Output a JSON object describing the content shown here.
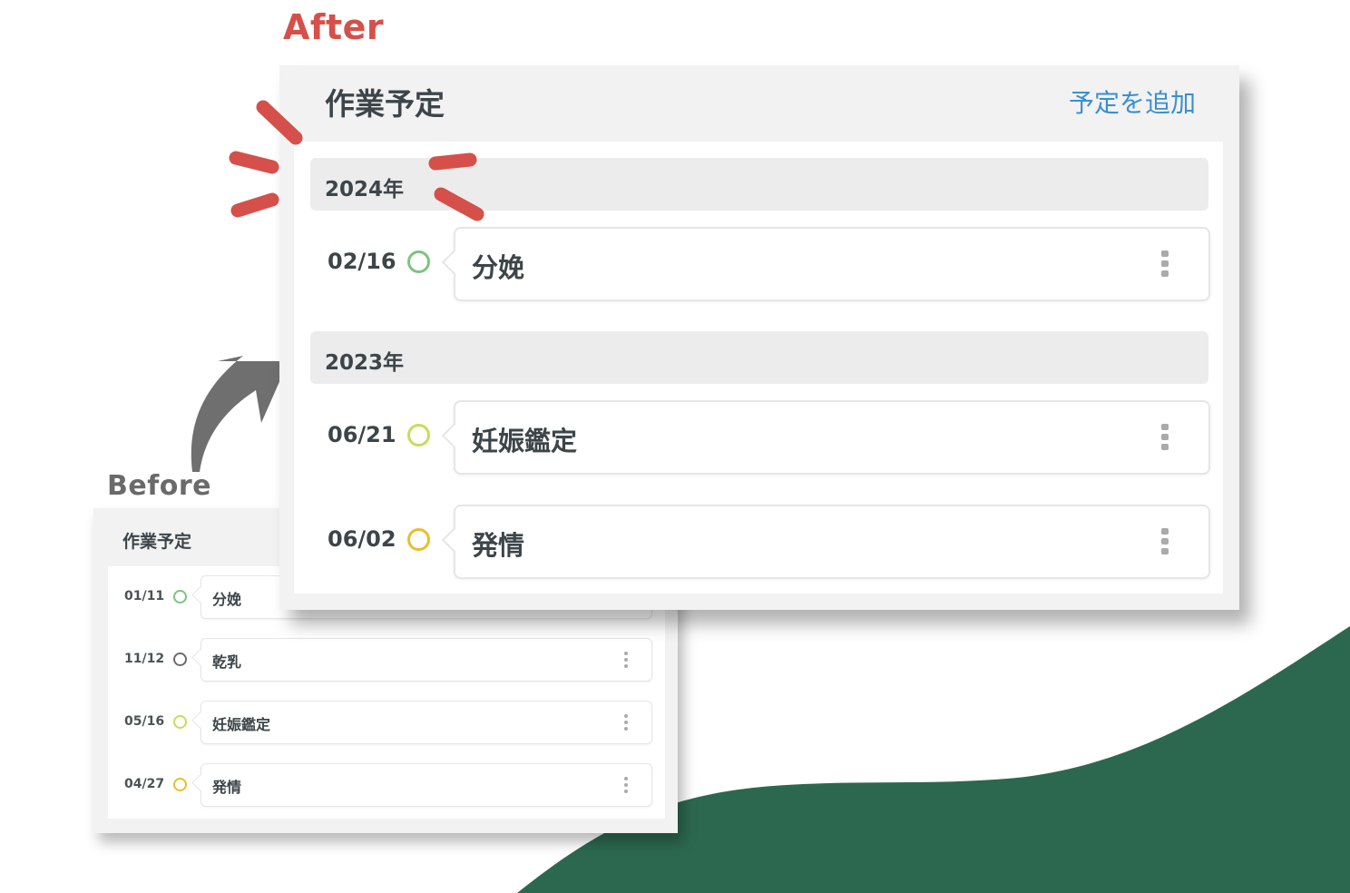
{
  "labels": {
    "after": "After",
    "before": "Before"
  },
  "colors": {
    "accent_red": "#d5504a",
    "wave_green": "#2c6850",
    "link_blue": "#3a8fcf",
    "ring_green": "#7cc47e",
    "ring_lime": "#c7dd5a",
    "ring_yellow": "#e8be2d",
    "ring_gray": "#6c6c6c"
  },
  "before": {
    "title": "作業予定",
    "items": [
      {
        "date": "01/11",
        "label": "分娩",
        "ring_color": "#7cc47e"
      },
      {
        "date": "11/12",
        "label": "乾乳",
        "ring_color": "#6c6c6c"
      },
      {
        "date": "05/16",
        "label": "妊娠鑑定",
        "ring_color": "#c7dd5a"
      },
      {
        "date": "04/27",
        "label": "発情",
        "ring_color": "#e8be2d"
      }
    ]
  },
  "after": {
    "title": "作業予定",
    "add_link": "予定を追加",
    "groups": [
      {
        "year": "2024年",
        "items": [
          {
            "date": "02/16",
            "label": "分娩",
            "ring_color": "#7cc47e"
          }
        ]
      },
      {
        "year": "2023年",
        "items": [
          {
            "date": "06/21",
            "label": "妊娠鑑定",
            "ring_color": "#c7dd5a"
          },
          {
            "date": "06/02",
            "label": "発情",
            "ring_color": "#e8be2d"
          }
        ]
      }
    ]
  }
}
